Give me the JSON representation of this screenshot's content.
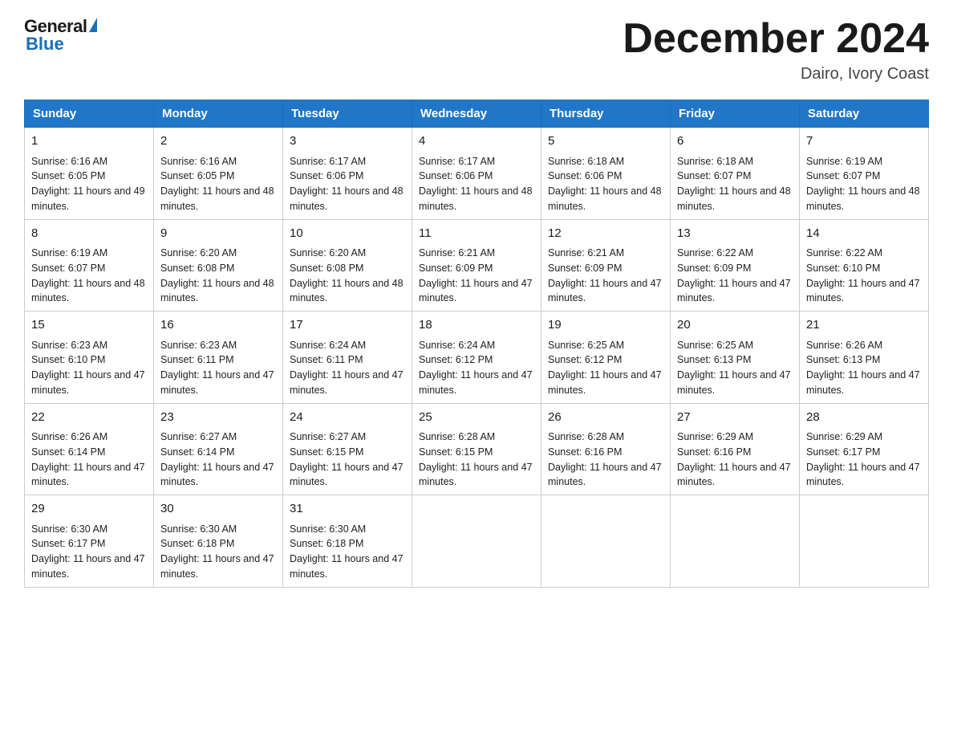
{
  "logo": {
    "general": "General",
    "blue": "Blue"
  },
  "title": "December 2024",
  "location": "Dairo, Ivory Coast",
  "headers": [
    "Sunday",
    "Monday",
    "Tuesday",
    "Wednesday",
    "Thursday",
    "Friday",
    "Saturday"
  ],
  "weeks": [
    [
      {
        "day": "1",
        "sunrise": "Sunrise: 6:16 AM",
        "sunset": "Sunset: 6:05 PM",
        "daylight": "Daylight: 11 hours and 49 minutes."
      },
      {
        "day": "2",
        "sunrise": "Sunrise: 6:16 AM",
        "sunset": "Sunset: 6:05 PM",
        "daylight": "Daylight: 11 hours and 48 minutes."
      },
      {
        "day": "3",
        "sunrise": "Sunrise: 6:17 AM",
        "sunset": "Sunset: 6:06 PM",
        "daylight": "Daylight: 11 hours and 48 minutes."
      },
      {
        "day": "4",
        "sunrise": "Sunrise: 6:17 AM",
        "sunset": "Sunset: 6:06 PM",
        "daylight": "Daylight: 11 hours and 48 minutes."
      },
      {
        "day": "5",
        "sunrise": "Sunrise: 6:18 AM",
        "sunset": "Sunset: 6:06 PM",
        "daylight": "Daylight: 11 hours and 48 minutes."
      },
      {
        "day": "6",
        "sunrise": "Sunrise: 6:18 AM",
        "sunset": "Sunset: 6:07 PM",
        "daylight": "Daylight: 11 hours and 48 minutes."
      },
      {
        "day": "7",
        "sunrise": "Sunrise: 6:19 AM",
        "sunset": "Sunset: 6:07 PM",
        "daylight": "Daylight: 11 hours and 48 minutes."
      }
    ],
    [
      {
        "day": "8",
        "sunrise": "Sunrise: 6:19 AM",
        "sunset": "Sunset: 6:07 PM",
        "daylight": "Daylight: 11 hours and 48 minutes."
      },
      {
        "day": "9",
        "sunrise": "Sunrise: 6:20 AM",
        "sunset": "Sunset: 6:08 PM",
        "daylight": "Daylight: 11 hours and 48 minutes."
      },
      {
        "day": "10",
        "sunrise": "Sunrise: 6:20 AM",
        "sunset": "Sunset: 6:08 PM",
        "daylight": "Daylight: 11 hours and 48 minutes."
      },
      {
        "day": "11",
        "sunrise": "Sunrise: 6:21 AM",
        "sunset": "Sunset: 6:09 PM",
        "daylight": "Daylight: 11 hours and 47 minutes."
      },
      {
        "day": "12",
        "sunrise": "Sunrise: 6:21 AM",
        "sunset": "Sunset: 6:09 PM",
        "daylight": "Daylight: 11 hours and 47 minutes."
      },
      {
        "day": "13",
        "sunrise": "Sunrise: 6:22 AM",
        "sunset": "Sunset: 6:09 PM",
        "daylight": "Daylight: 11 hours and 47 minutes."
      },
      {
        "day": "14",
        "sunrise": "Sunrise: 6:22 AM",
        "sunset": "Sunset: 6:10 PM",
        "daylight": "Daylight: 11 hours and 47 minutes."
      }
    ],
    [
      {
        "day": "15",
        "sunrise": "Sunrise: 6:23 AM",
        "sunset": "Sunset: 6:10 PM",
        "daylight": "Daylight: 11 hours and 47 minutes."
      },
      {
        "day": "16",
        "sunrise": "Sunrise: 6:23 AM",
        "sunset": "Sunset: 6:11 PM",
        "daylight": "Daylight: 11 hours and 47 minutes."
      },
      {
        "day": "17",
        "sunrise": "Sunrise: 6:24 AM",
        "sunset": "Sunset: 6:11 PM",
        "daylight": "Daylight: 11 hours and 47 minutes."
      },
      {
        "day": "18",
        "sunrise": "Sunrise: 6:24 AM",
        "sunset": "Sunset: 6:12 PM",
        "daylight": "Daylight: 11 hours and 47 minutes."
      },
      {
        "day": "19",
        "sunrise": "Sunrise: 6:25 AM",
        "sunset": "Sunset: 6:12 PM",
        "daylight": "Daylight: 11 hours and 47 minutes."
      },
      {
        "day": "20",
        "sunrise": "Sunrise: 6:25 AM",
        "sunset": "Sunset: 6:13 PM",
        "daylight": "Daylight: 11 hours and 47 minutes."
      },
      {
        "day": "21",
        "sunrise": "Sunrise: 6:26 AM",
        "sunset": "Sunset: 6:13 PM",
        "daylight": "Daylight: 11 hours and 47 minutes."
      }
    ],
    [
      {
        "day": "22",
        "sunrise": "Sunrise: 6:26 AM",
        "sunset": "Sunset: 6:14 PM",
        "daylight": "Daylight: 11 hours and 47 minutes."
      },
      {
        "day": "23",
        "sunrise": "Sunrise: 6:27 AM",
        "sunset": "Sunset: 6:14 PM",
        "daylight": "Daylight: 11 hours and 47 minutes."
      },
      {
        "day": "24",
        "sunrise": "Sunrise: 6:27 AM",
        "sunset": "Sunset: 6:15 PM",
        "daylight": "Daylight: 11 hours and 47 minutes."
      },
      {
        "day": "25",
        "sunrise": "Sunrise: 6:28 AM",
        "sunset": "Sunset: 6:15 PM",
        "daylight": "Daylight: 11 hours and 47 minutes."
      },
      {
        "day": "26",
        "sunrise": "Sunrise: 6:28 AM",
        "sunset": "Sunset: 6:16 PM",
        "daylight": "Daylight: 11 hours and 47 minutes."
      },
      {
        "day": "27",
        "sunrise": "Sunrise: 6:29 AM",
        "sunset": "Sunset: 6:16 PM",
        "daylight": "Daylight: 11 hours and 47 minutes."
      },
      {
        "day": "28",
        "sunrise": "Sunrise: 6:29 AM",
        "sunset": "Sunset: 6:17 PM",
        "daylight": "Daylight: 11 hours and 47 minutes."
      }
    ],
    [
      {
        "day": "29",
        "sunrise": "Sunrise: 6:30 AM",
        "sunset": "Sunset: 6:17 PM",
        "daylight": "Daylight: 11 hours and 47 minutes."
      },
      {
        "day": "30",
        "sunrise": "Sunrise: 6:30 AM",
        "sunset": "Sunset: 6:18 PM",
        "daylight": "Daylight: 11 hours and 47 minutes."
      },
      {
        "day": "31",
        "sunrise": "Sunrise: 6:30 AM",
        "sunset": "Sunset: 6:18 PM",
        "daylight": "Daylight: 11 hours and 47 minutes."
      },
      null,
      null,
      null,
      null
    ]
  ]
}
